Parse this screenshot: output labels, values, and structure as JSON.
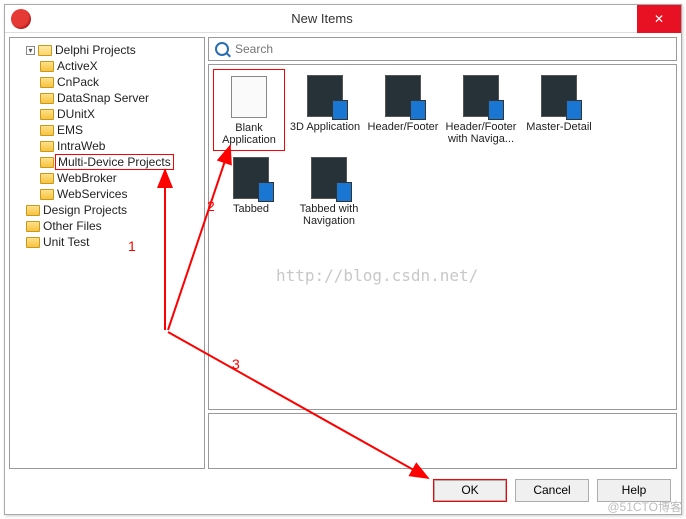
{
  "window": {
    "title": "New Items"
  },
  "tree": {
    "root": {
      "label": "Delphi Projects",
      "children": [
        {
          "label": "ActiveX"
        },
        {
          "label": "CnPack"
        },
        {
          "label": "DataSnap Server"
        },
        {
          "label": "DUnitX"
        },
        {
          "label": "EMS"
        },
        {
          "label": "IntraWeb"
        },
        {
          "label": "Multi-Device Projects"
        },
        {
          "label": "WebBroker"
        },
        {
          "label": "WebServices"
        }
      ]
    },
    "siblings": [
      {
        "label": "Design Projects"
      },
      {
        "label": "Other Files"
      },
      {
        "label": "Unit Test"
      }
    ]
  },
  "search": {
    "placeholder": "Search"
  },
  "items": [
    {
      "label": "Blank Application",
      "selected": true,
      "blank": true
    },
    {
      "label": "3D Application"
    },
    {
      "label": "Header/Footer"
    },
    {
      "label": "Header/Footer with Naviga..."
    },
    {
      "label": "Master-Detail"
    },
    {
      "label": "Tabbed"
    },
    {
      "label": "Tabbed with Navigation"
    }
  ],
  "buttons": {
    "ok": "OK",
    "cancel": "Cancel",
    "help": "Help"
  },
  "annotations": {
    "one": "1",
    "two": "2",
    "three": "3"
  },
  "watermark": "http://blog.csdn.net/",
  "credit": "@51CTO博客"
}
